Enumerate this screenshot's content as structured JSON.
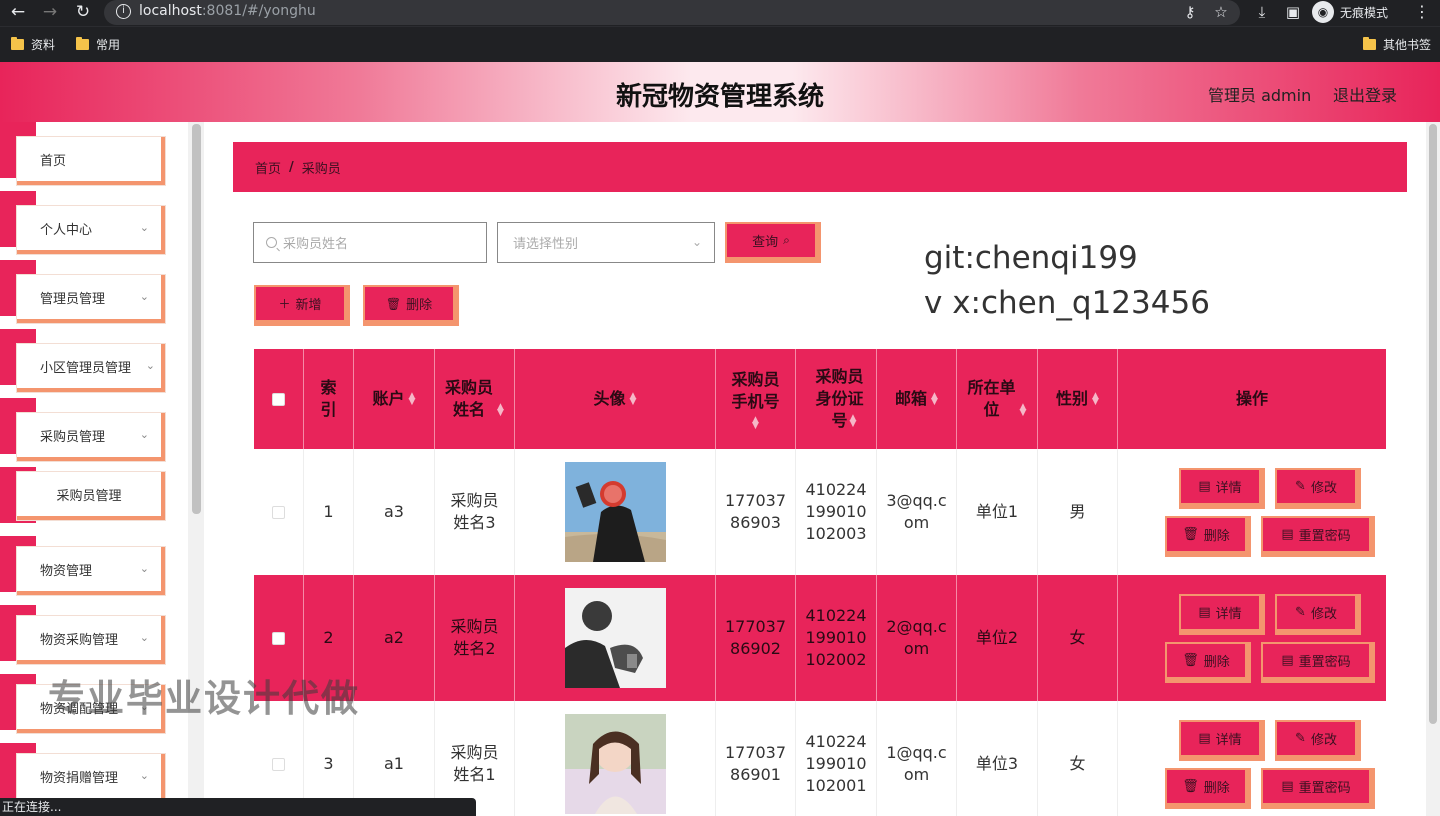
{
  "browser": {
    "url_host": "localhost",
    "url_rest": ":8081/#/yonghu",
    "incognito_label": "无痕模式",
    "bookmarks": [
      "资料",
      "常用"
    ],
    "other_bookmarks": "其他书签",
    "status_text": "正在连接..."
  },
  "header": {
    "title": "新冠物资管理系统",
    "admin_label": "管理员 admin",
    "logout": "退出登录"
  },
  "sidebar": {
    "items": [
      {
        "label": "首页",
        "has_arrow": false
      },
      {
        "label": "个人中心",
        "has_arrow": true
      },
      {
        "label": "管理员管理",
        "has_arrow": true
      },
      {
        "label": "小区管理员管理",
        "has_arrow": true
      },
      {
        "label": "采购员管理",
        "has_arrow": true
      },
      {
        "label": "采购员管理",
        "submenu": true
      },
      {
        "label": "物资管理",
        "has_arrow": true
      },
      {
        "label": "物资采购管理",
        "has_arrow": true
      },
      {
        "label": "物资调配管理",
        "has_arrow": true
      },
      {
        "label": "物资捐赠管理",
        "has_arrow": true
      }
    ]
  },
  "breadcrumb": {
    "home": "首页",
    "sep": "/",
    "current": "采购员"
  },
  "search": {
    "name_placeholder": "采购员姓名",
    "gender_placeholder": "请选择性别",
    "query_label": "查询",
    "add_label": "新增",
    "delete_label": "删除"
  },
  "overlay": {
    "git": "git:chenqi199",
    "wx": "v x:chen_q123456",
    "center": "专业毕业设计代做"
  },
  "table": {
    "headers": {
      "index": "索\n引",
      "account": "账户",
      "name": "采购员\n姓名",
      "avatar": "头像",
      "phone": "采购员\n手机号",
      "idcard": "采购员\n身份证\n号",
      "email": "邮箱",
      "unit": "所在单\n位",
      "gender": "性别",
      "ops": "操作"
    },
    "ops": {
      "detail": "详情",
      "edit": "修改",
      "delete": "删除",
      "reset": "重置密码"
    },
    "rows": [
      {
        "index": "1",
        "account": "a3",
        "name": "采购员\n姓名3",
        "phone": "177037\n86903",
        "idcard": "410224\n199010\n102003",
        "email": "3@qq.c\nom",
        "unit": "单位1",
        "gender": "男"
      },
      {
        "index": "2",
        "account": "a2",
        "name": "采购员\n姓名2",
        "phone": "177037\n86902",
        "idcard": "410224\n199010\n102002",
        "email": "2@qq.c\nom",
        "unit": "单位2",
        "gender": "女"
      },
      {
        "index": "3",
        "account": "a1",
        "name": "采购员\n姓名1",
        "phone": "177037\n86901",
        "idcard": "410224\n199010\n102001",
        "email": "1@qq.c\nom",
        "unit": "单位3",
        "gender": "女"
      }
    ]
  },
  "colors": {
    "primary": "#e8245a",
    "accent_border": "#f4956e"
  }
}
